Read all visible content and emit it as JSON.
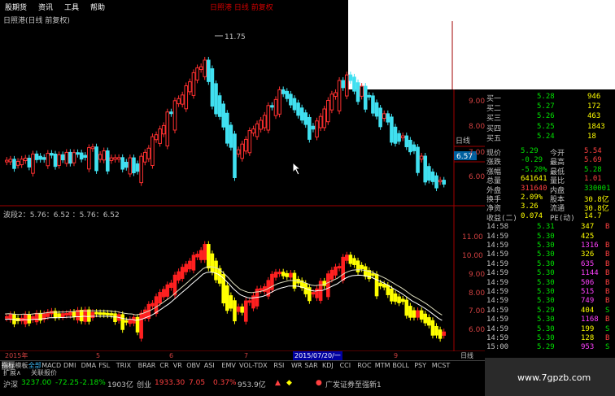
{
  "menu": {
    "items": [
      "股期货",
      "资讯",
      "工具",
      "帮助"
    ],
    "center_title": "日照港 日线 前复权"
  },
  "main_chart": {
    "title": "日照港(日线 前复权)",
    "price_labels": [
      "9.00",
      "8.00",
      "7.00",
      "6.00"
    ],
    "peak_label": "11.75",
    "current_price_tag": "6.57",
    "panel_label": "日线"
  },
  "indicator_chart": {
    "title": "波段2：5.76：6.52  ：5.76：6.52",
    "price_labels": [
      "11.00",
      "10.00",
      "9.00",
      "8.00",
      "7.00",
      "6.00"
    ]
  },
  "date_axis": {
    "labels": [
      "2015年",
      "5",
      "6",
      "7",
      "2015/07/20/一",
      "9"
    ],
    "panel_label": "日线"
  },
  "quote": {
    "rows": [
      {
        "label": "买一",
        "value": "5.28",
        "vol": "946",
        "c1": "#00e000",
        "c2": "#ffff00"
      },
      {
        "label": "买二",
        "value": "5.27",
        "vol": "172",
        "c1": "#00e000",
        "c2": "#ffff00"
      },
      {
        "label": "买三",
        "value": "5.26",
        "vol": "463",
        "c1": "#00e000",
        "c2": "#ffff00"
      },
      {
        "label": "买四",
        "value": "5.25",
        "vol": "1843",
        "c1": "#00e000",
        "c2": "#ffff00"
      },
      {
        "label": "买五",
        "value": "5.24",
        "vol": "18",
        "c1": "#00e000",
        "c2": "#ffff00"
      }
    ],
    "stats": [
      {
        "l1": "现价",
        "v1": "5.29",
        "l2": "今开",
        "v2": "5.54",
        "c1": "#00e000",
        "c2": "#ff4040"
      },
      {
        "l1": "涨跌",
        "v1": "-0.29",
        "l2": "最高",
        "v2": "5.69",
        "c1": "#00e000",
        "c2": "#ff4040"
      },
      {
        "l1": "涨幅",
        "v1": "-5.20%",
        "l2": "最低",
        "v2": "5.28",
        "c1": "#00e000",
        "c2": "#00e000"
      },
      {
        "l1": "总量",
        "v1": "641641",
        "l2": "量比",
        "v2": "1.01",
        "c1": "#ffff00",
        "c2": "#ff4040"
      },
      {
        "l1": "外盘",
        "v1": "311640",
        "l2": "内盘",
        "v2": "330001",
        "c1": "#ff4040",
        "c2": "#00e000"
      },
      {
        "l1": "换手",
        "v1": "2.09%",
        "l2": "股本",
        "v2": "30.8亿",
        "c1": "#ffff00",
        "c2": "#ffff00"
      },
      {
        "l1": "净资",
        "v1": "3.26",
        "l2": "流通",
        "v2": "30.8亿",
        "c1": "#ffff00",
        "c2": "#ffff00"
      },
      {
        "l1": "收益(二)",
        "v1": "0.074",
        "l2": "PE(动)",
        "v2": "14.7",
        "c1": "#ffff00",
        "c2": "#ffff00"
      }
    ],
    "ticks": [
      {
        "time": "14:58",
        "price": "5.31",
        "vol": "347",
        "dir": "B",
        "vc": "#ffff00"
      },
      {
        "time": "14:59",
        "price": "5.30",
        "vol": "425",
        "dir": "",
        "vc": "#ffff00"
      },
      {
        "time": "14:59",
        "price": "5.30",
        "vol": "1316",
        "dir": "B",
        "vc": "#ff40ff"
      },
      {
        "time": "14:59",
        "price": "5.30",
        "vol": "326",
        "dir": "B",
        "vc": "#ffff00"
      },
      {
        "time": "14:59",
        "price": "5.30",
        "vol": "635",
        "dir": "B",
        "vc": "#ff40ff"
      },
      {
        "time": "14:59",
        "price": "5.30",
        "vol": "1144",
        "dir": "B",
        "vc": "#ff40ff"
      },
      {
        "time": "14:59",
        "price": "5.30",
        "vol": "506",
        "dir": "B",
        "vc": "#ff40ff"
      },
      {
        "time": "14:59",
        "price": "5.30",
        "vol": "515",
        "dir": "B",
        "vc": "#ff40ff"
      },
      {
        "time": "14:59",
        "price": "5.30",
        "vol": "749",
        "dir": "B",
        "vc": "#ff40ff"
      },
      {
        "time": "14:59",
        "price": "5.29",
        "vol": "404",
        "dir": "S",
        "vc": "#ffff00"
      },
      {
        "time": "14:59",
        "price": "5.30",
        "vol": "1168",
        "dir": "B",
        "vc": "#ff40ff"
      },
      {
        "time": "14:59",
        "price": "5.30",
        "vol": "199",
        "dir": "S",
        "vc": "#ffff00"
      },
      {
        "time": "14:59",
        "price": "5.30",
        "vol": "128",
        "dir": "B",
        "vc": "#ffff00"
      },
      {
        "time": "15:00",
        "price": "5.29",
        "vol": "953",
        "dir": "S",
        "vc": "#ff40ff"
      }
    ]
  },
  "tabs": [
    "指标",
    "模板",
    "全部",
    "MACD",
    "DMI",
    "DMA",
    "FSL",
    "TRIX",
    "BRAR",
    "CR",
    "VR",
    "OBV",
    "ASI",
    "EMV",
    "VOL-TDX",
    "RSI",
    "WR",
    "SAR",
    "KDJ",
    "CCI",
    "ROC",
    "MTM",
    "BOLL",
    "PSY",
    "MCST"
  ],
  "subtabs": [
    "扩展∧",
    "关联报价"
  ],
  "status": {
    "index_name": "沪深",
    "index_value": "3237.00",
    "change": "-72.25",
    "pct": "-2.18%",
    "amount": "1903亿",
    "index2_name": "创业",
    "index2_value": "1933.30",
    "change2": "7.05",
    "pct2": "0.37%",
    "amount2": "953.9亿",
    "broker": "广发证券至强新1"
  },
  "watermark": "www.7gpzb.com"
}
